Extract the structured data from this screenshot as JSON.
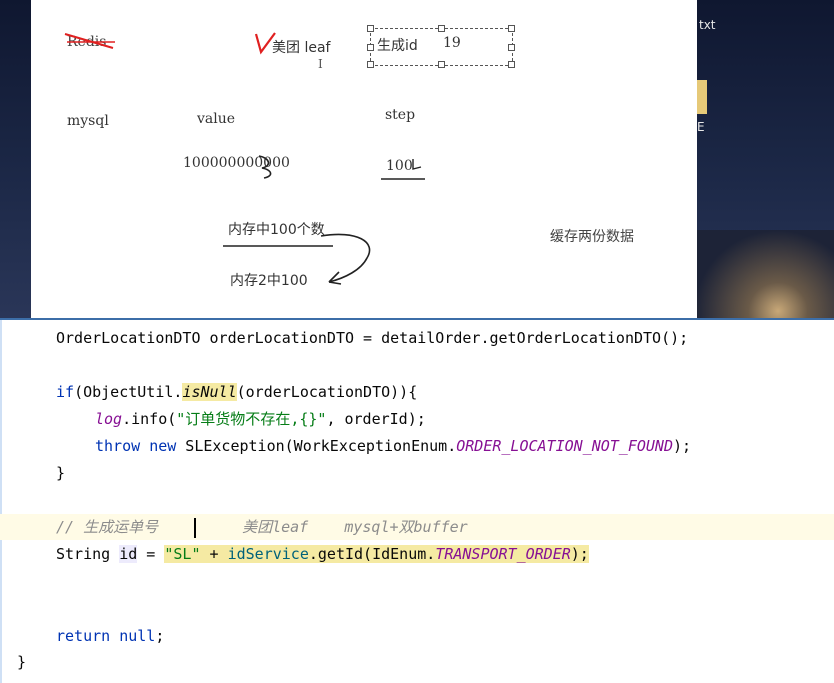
{
  "desktop": {
    "file_label_txt": "txt",
    "side_char": "E"
  },
  "whiteboard": {
    "redis": "Redis",
    "meituan_leaf": "美团 leaf",
    "text_cursor": "I",
    "gen_id": "生成id",
    "gen_id_value": "19",
    "mysql": "mysql",
    "value_label": "value",
    "step_label": "step",
    "value_number": "100000000000",
    "step_number": "100",
    "memory_100": "内存中100个数",
    "memory_2": "内存2中100",
    "cache_two": "缓存两份数据"
  },
  "code": {
    "line1_type": "OrderLocationDTO",
    "line1_var": " orderLocationDTO = detailOrder.getOrderLocationDTO();",
    "if_kw": "if",
    "if_util": "(ObjectUtil.",
    "if_method": "isNull",
    "if_rest": "(orderLocationDTO)){",
    "log_field": "log",
    "log_call": ".info(",
    "log_str": "\"订单货物不存在,{}\"",
    "log_rest": ", orderId);",
    "throw_kw": "throw",
    "new_kw": "new",
    "throw_rest": " SLException(WorkExceptionEnum.",
    "throw_const": "ORDER_LOCATION_NOT_FOUND",
    "throw_end": ");",
    "close_brace": "}",
    "comment_left": "// 生成运单号",
    "comment_right": "美团leaf    mysql+双buffer",
    "string_type": "String ",
    "id_var": "id",
    "eq": " = ",
    "sl_str": "\"SL\"",
    "plus": " + ",
    "id_service": "idService",
    "get_id": ".getId(IdEnum.",
    "transport_const": "TRANSPORT_ORDER",
    "get_id_end": ");",
    "return_kw": "return",
    "null_kw": "null",
    "return_end": ";",
    "final_brace": "}"
  }
}
